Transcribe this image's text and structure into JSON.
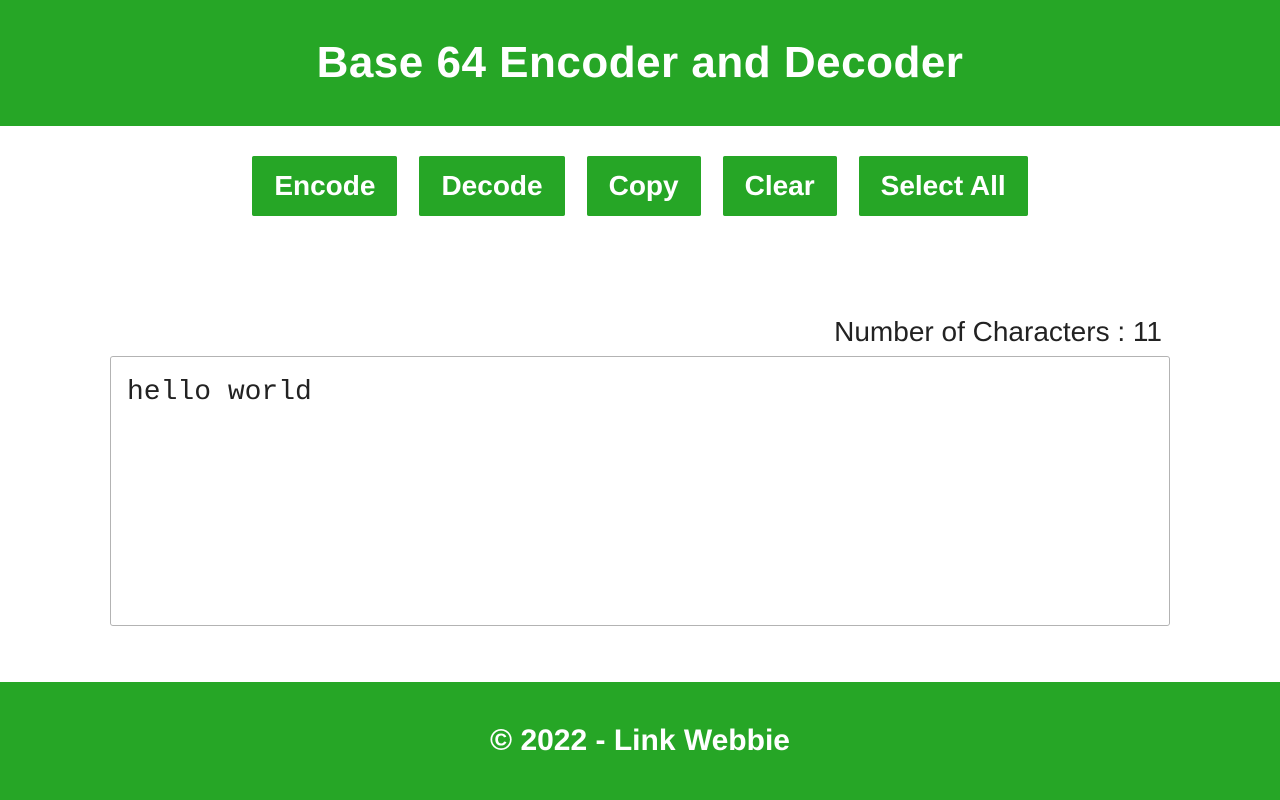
{
  "header": {
    "title": "Base 64 Encoder and Decoder"
  },
  "toolbar": {
    "encode_label": "Encode",
    "decode_label": "Decode",
    "copy_label": "Copy",
    "clear_label": "Clear",
    "select_all_label": "Select All"
  },
  "content": {
    "char_count_label": "Number of Characters : ",
    "char_count_value": "11",
    "textarea_value": "hello world"
  },
  "footer": {
    "copyright": "© 2022 - Link Webbie"
  }
}
